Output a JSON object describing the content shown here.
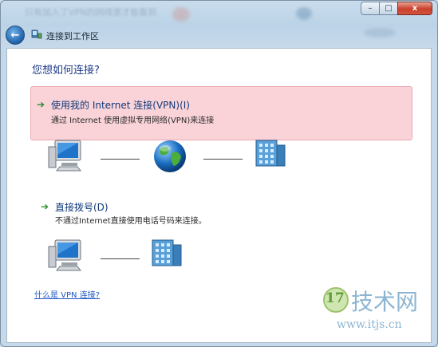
{
  "window": {
    "title_faded": "只有加入了VPN的网络里才能看到",
    "caption_buttons": {
      "minimize": "–",
      "maximize": "□",
      "close": "x"
    }
  },
  "nav": {
    "title": "连接到工作区"
  },
  "content": {
    "heading": "您想如何连接?",
    "options": [
      {
        "title": "使用我的 Internet 连接(VPN)(I)",
        "desc": "通过 Internet 使用虚拟专用网络(VPN)来连接"
      },
      {
        "title": "直接拨号(D)",
        "desc": "不通过Internet直接使用电话号码来连接。"
      }
    ],
    "link": "什么是 VPN 连接?"
  },
  "watermark": {
    "logo": "17",
    "text": "技术网",
    "url": "www.itjs.cn"
  },
  "colors": {
    "selection_bg": "#f9d3d8",
    "link": "#1c56c4",
    "heading": "#1e3a8a"
  }
}
